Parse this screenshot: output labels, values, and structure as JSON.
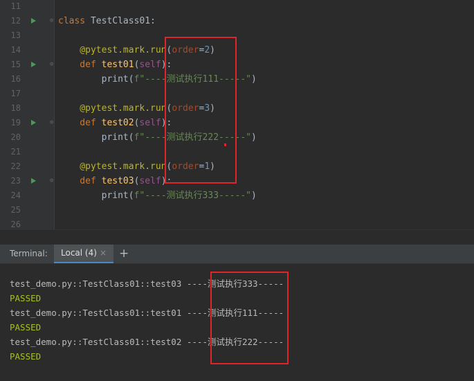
{
  "editor": {
    "lines": [
      {
        "num": "11",
        "code": []
      },
      {
        "num": "12",
        "run": true,
        "fold": true,
        "code": [
          {
            "t": "class ",
            "c": "kw"
          },
          {
            "t": "TestClass01:",
            "c": "plain"
          }
        ]
      },
      {
        "num": "13",
        "code": []
      },
      {
        "num": "14",
        "code": [
          {
            "t": "    @pytest.mark.run",
            "c": "deco"
          },
          {
            "t": "(",
            "c": "plain"
          },
          {
            "t": "order",
            "c": "param"
          },
          {
            "t": "=",
            "c": "plain"
          },
          {
            "t": "2",
            "c": "num"
          },
          {
            "t": ")",
            "c": "plain"
          }
        ]
      },
      {
        "num": "15",
        "run": true,
        "fold": true,
        "code": [
          {
            "t": "    def ",
            "c": "kw"
          },
          {
            "t": "test01",
            "c": "fn"
          },
          {
            "t": "(",
            "c": "plain"
          },
          {
            "t": "self",
            "c": "self"
          },
          {
            "t": "):",
            "c": "plain"
          }
        ]
      },
      {
        "num": "16",
        "code": [
          {
            "t": "        print",
            "c": "plain"
          },
          {
            "t": "(",
            "c": "plain"
          },
          {
            "t": "f\"----测试执行111-----\"",
            "c": "str"
          },
          {
            "t": ")",
            "c": "plain"
          }
        ]
      },
      {
        "num": "17",
        "code": []
      },
      {
        "num": "18",
        "code": [
          {
            "t": "    @pytest.mark.run",
            "c": "deco"
          },
          {
            "t": "(",
            "c": "plain"
          },
          {
            "t": "order",
            "c": "param"
          },
          {
            "t": "=",
            "c": "plain"
          },
          {
            "t": "3",
            "c": "num"
          },
          {
            "t": ")",
            "c": "plain"
          }
        ]
      },
      {
        "num": "19",
        "run": true,
        "fold": true,
        "code": [
          {
            "t": "    def ",
            "c": "kw"
          },
          {
            "t": "test02",
            "c": "fn"
          },
          {
            "t": "(",
            "c": "plain"
          },
          {
            "t": "self",
            "c": "self"
          },
          {
            "t": "):",
            "c": "plain"
          }
        ]
      },
      {
        "num": "20",
        "code": [
          {
            "t": "        print",
            "c": "plain"
          },
          {
            "t": "(",
            "c": "plain"
          },
          {
            "t": "f\"----测试执行222-----\"",
            "c": "str"
          },
          {
            "t": ")",
            "c": "plain"
          }
        ]
      },
      {
        "num": "21",
        "code": []
      },
      {
        "num": "22",
        "code": [
          {
            "t": "    @pytest.mark.run",
            "c": "deco"
          },
          {
            "t": "(",
            "c": "plain"
          },
          {
            "t": "order",
            "c": "param"
          },
          {
            "t": "=",
            "c": "plain"
          },
          {
            "t": "1",
            "c": "num"
          },
          {
            "t": ")",
            "c": "plain"
          }
        ]
      },
      {
        "num": "23",
        "run": true,
        "fold": true,
        "code": [
          {
            "t": "    def ",
            "c": "kw"
          },
          {
            "t": "test03",
            "c": "fn"
          },
          {
            "t": "(",
            "c": "plain"
          },
          {
            "t": "self",
            "c": "self"
          },
          {
            "t": "):",
            "c": "plain"
          }
        ]
      },
      {
        "num": "24",
        "code": [
          {
            "t": "        print",
            "c": "plain"
          },
          {
            "t": "(",
            "c": "plain"
          },
          {
            "t": "f\"----测试执行333-----\"",
            "c": "str"
          },
          {
            "t": ")",
            "c": "plain"
          }
        ]
      },
      {
        "num": "25",
        "code": []
      },
      {
        "num": "26",
        "code": []
      }
    ]
  },
  "terminal": {
    "label": "Terminal:",
    "tab_label": "Local (4)",
    "tab_close": "×",
    "new_tab": "+",
    "lines": [
      {
        "text": "",
        "passed": false
      },
      {
        "text": "test_demo.py::TestClass01::test03 ----测试执行333-----",
        "passed": false
      },
      {
        "text": "PASSED",
        "passed": true
      },
      {
        "text": "test_demo.py::TestClass01::test01 ----测试执行111-----",
        "passed": false
      },
      {
        "text": "PASSED",
        "passed": true
      },
      {
        "text": "test_demo.py::TestClass01::test02 ----测试执行222-----",
        "passed": false
      },
      {
        "text": "PASSED",
        "passed": true
      }
    ]
  },
  "colors": {
    "keyword": "#cc7832",
    "decorator": "#bbb529",
    "param": "#aa4926",
    "number": "#6897bb",
    "function": "#ffc66d",
    "self": "#94558d",
    "string": "#6a8759",
    "passed": "#a8c023",
    "highlight": "#e0242a"
  }
}
